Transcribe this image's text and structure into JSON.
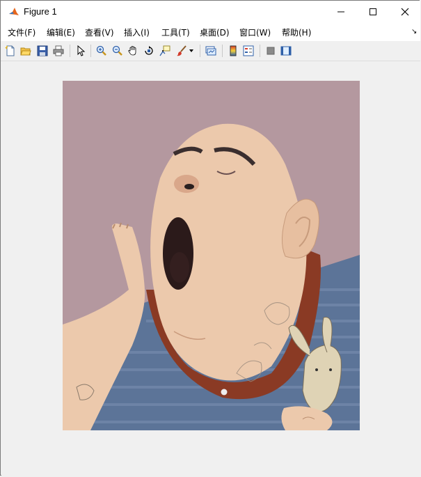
{
  "window": {
    "title": "Figure 1",
    "controls": {
      "minimize": "minimize",
      "maximize": "maximize",
      "close": "close"
    }
  },
  "menu": {
    "items": [
      {
        "label": "文件(F)"
      },
      {
        "label": "编辑(E)"
      },
      {
        "label": "查看(V)"
      },
      {
        "label": "插入(I)"
      },
      {
        "label": "工具(T)"
      },
      {
        "label": "桌面(D)"
      },
      {
        "label": "窗口(W)"
      },
      {
        "label": "帮助(H)"
      }
    ],
    "overflow_arrow": "↘"
  },
  "toolbar": {
    "icons": [
      "new-figure-icon",
      "open-file-icon",
      "save-icon",
      "print-icon",
      "pointer-icon",
      "zoom-in-icon",
      "zoom-out-icon",
      "pan-hand-icon",
      "rotate-3d-icon",
      "data-cursor-icon",
      "brush-icon",
      "brush-dropdown-icon",
      "link-plot-icon",
      "colorbar-icon",
      "legend-icon",
      "hide-plot-tools-icon",
      "show-plot-tools-icon"
    ]
  },
  "figure": {
    "image_description_name": "yawning-man-illustration",
    "colors": {
      "background": "#b89ba2",
      "skin": "#ecc9ac",
      "shirt": "#5c7498",
      "collar": "#8a3a24"
    }
  }
}
